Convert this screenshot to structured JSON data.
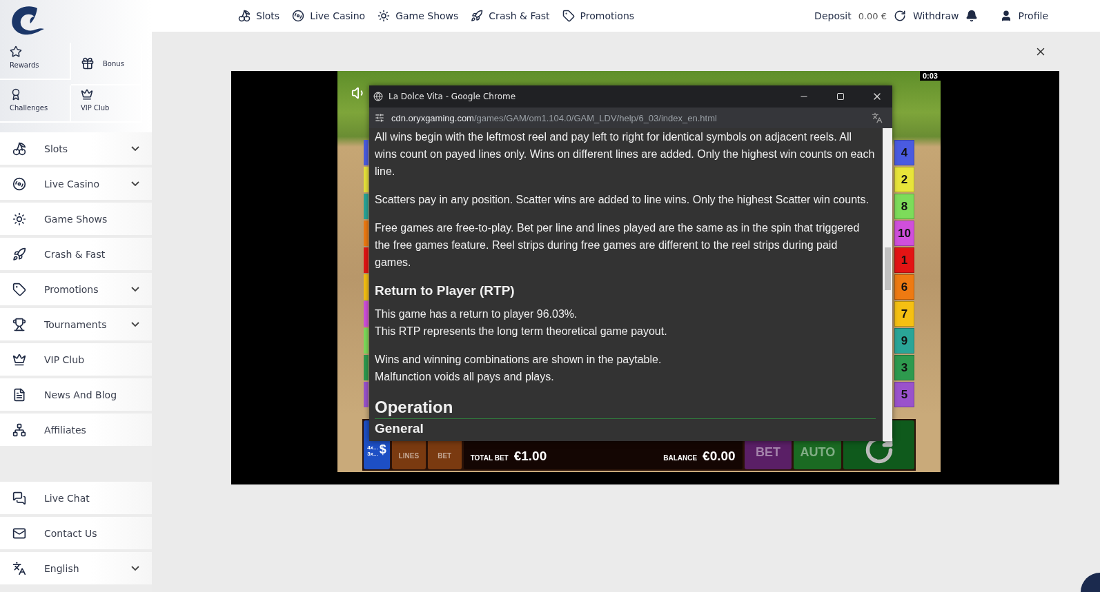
{
  "quick_links": [
    {
      "label": "Rewards",
      "kind": "stacked"
    },
    {
      "label": "Bonus",
      "kind": "inline"
    },
    {
      "label": "Challenges",
      "kind": "stacked"
    },
    {
      "label": "VIP Club",
      "kind": "stacked"
    }
  ],
  "sidebar": {
    "items": [
      {
        "label": "Slots",
        "expandable": true
      },
      {
        "label": "Live Casino",
        "expandable": true
      },
      {
        "label": "Game Shows",
        "expandable": false
      },
      {
        "label": "Crash & Fast",
        "expandable": false
      },
      {
        "label": "Promotions",
        "expandable": true
      },
      {
        "label": "Tournaments",
        "expandable": true
      },
      {
        "label": "VIP Club",
        "expandable": false
      },
      {
        "label": "News And Blog",
        "expandable": false
      },
      {
        "label": "Affiliates",
        "expandable": false
      }
    ],
    "footer_items": [
      {
        "label": "Live Chat",
        "expandable": false
      },
      {
        "label": "Contact Us",
        "expandable": false
      },
      {
        "label": "English",
        "expandable": true
      }
    ]
  },
  "top_nav": {
    "items": [
      "Slots",
      "Live Casino",
      "Game Shows",
      "Crash & Fast",
      "Promotions"
    ],
    "deposit": "Deposit",
    "balance": "0.00 €",
    "withdraw": "Withdraw",
    "profile": "Profile"
  },
  "game": {
    "timer": "0:03",
    "reel_markers": [
      {
        "color": "#4a5be0"
      },
      {
        "color": "#e8e43a"
      },
      {
        "color": "#2aa597"
      },
      {
        "color": "#ee7a12"
      },
      {
        "color": "#e31414"
      },
      {
        "color": "#f5c012"
      },
      {
        "color": "#d04fdc"
      },
      {
        "color": "#7ddc5a"
      },
      {
        "color": "#2e9a4e"
      },
      {
        "color": "#9a52cc"
      }
    ],
    "paylines": [
      {
        "label": "4",
        "color": "#4a5be0"
      },
      {
        "label": "2",
        "color": "#e8e43a"
      },
      {
        "label": "8",
        "color": "#7ddc5a"
      },
      {
        "label": "10",
        "color": "#d04fdc"
      },
      {
        "label": "1",
        "color": "#e31414"
      },
      {
        "label": "6",
        "color": "#ee7a12"
      },
      {
        "label": "7",
        "color": "#f5c012"
      },
      {
        "label": "9",
        "color": "#2aa597"
      },
      {
        "label": "3",
        "color": "#2e9a4e"
      },
      {
        "label": "5",
        "color": "#9a52cc"
      }
    ],
    "popup": {
      "title": "La Dolce Vita - Google Chrome",
      "url_domain": "cdn.oryxgaming.com",
      "url_path": "/games/GAM/om1.104.0/GAM_LDV/help/6_03/index_en.html",
      "content": [
        {
          "kind": "paragraph",
          "lines": [
            "All wins begin with the leftmost reel and pay left to right for identical symbols on adjacent reels. All wins count on payed lines only. Wins on different lines are added. Only the highest win counts on each line."
          ]
        },
        {
          "kind": "paragraph",
          "lines": [
            "Scatters pay in any position. Scatter wins are added to line wins. Only the highest Scatter win counts."
          ]
        },
        {
          "kind": "paragraph",
          "lines": [
            "Free games are free-to-play. Bet per line and lines played are the same as in the spin that triggered the free games feature. Reel strips during free games are different to the reel strips during paid games."
          ]
        },
        {
          "kind": "heading",
          "lines": [
            "Return to Player (RTP)"
          ]
        },
        {
          "kind": "paragraph",
          "lines": [
            "This game has a return to player 96.03%.",
            "This RTP represents the long term theoretical game payout."
          ]
        },
        {
          "kind": "paragraph",
          "lines": [
            "Wins and winning combinations are shown in the paytable.",
            "Malfunction voids all pays and plays."
          ]
        },
        {
          "kind": "title",
          "lines": [
            "Operation"
          ]
        },
        {
          "kind": "ruled",
          "lines": [
            "General"
          ]
        }
      ]
    },
    "bottom_bar": {
      "stake_legend": [
        "4x...",
        "3x..."
      ],
      "currency_symbol": "$",
      "lines_label": "LINES",
      "bet_label": "BET",
      "total_bet_label": "TOTAL BET",
      "total_bet": "€1.00",
      "balance_label": "BALANCE",
      "balance": "€0.00",
      "max_bet_label": "BET",
      "auto_label": "AUTO"
    }
  }
}
